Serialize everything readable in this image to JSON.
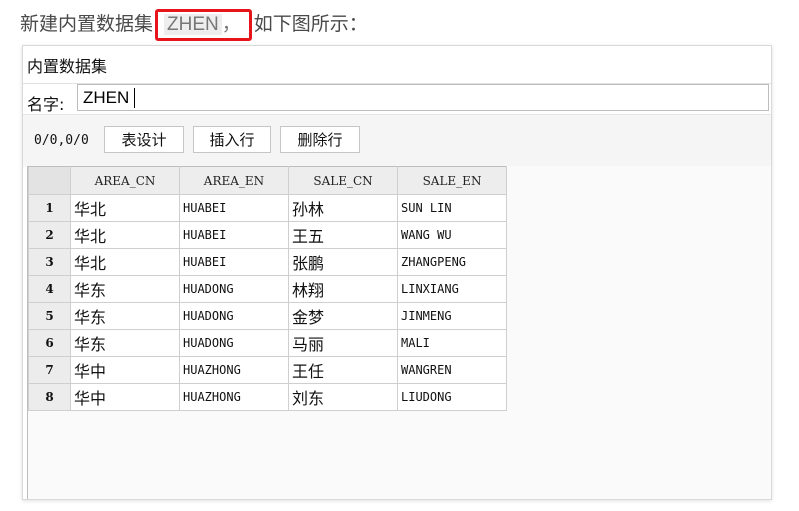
{
  "caption": {
    "before": "新建内置数据集",
    "highlight": "ZHEN",
    "highlight_suffix": "，",
    "after": "如下图所示：",
    "highlight_color": "#e8141c"
  },
  "dialog": {
    "title": "内置数据集",
    "name_label": "名字:",
    "name_value": "ZHEN"
  },
  "toolbar": {
    "count": "0/0,0/0",
    "table_design": "表设计",
    "insert_row": "插入行",
    "delete_row": "删除行"
  },
  "grid": {
    "columns": [
      "AREA_CN",
      "AREA_EN",
      "SALE_CN",
      "SALE_EN"
    ],
    "rows": [
      {
        "num": "1",
        "area_cn": "华北",
        "area_en": "HUABEI",
        "sale_cn": "孙林",
        "sale_en": "SUN LIN"
      },
      {
        "num": "2",
        "area_cn": "华北",
        "area_en": "HUABEI",
        "sale_cn": "王五",
        "sale_en": "WANG WU"
      },
      {
        "num": "3",
        "area_cn": "华北",
        "area_en": "HUABEI",
        "sale_cn": "张鹏",
        "sale_en": "ZHANGPENG"
      },
      {
        "num": "4",
        "area_cn": "华东",
        "area_en": "HUADONG",
        "sale_cn": "林翔",
        "sale_en": "LINXIANG"
      },
      {
        "num": "5",
        "area_cn": "华东",
        "area_en": "HUADONG",
        "sale_cn": "金梦",
        "sale_en": "JINMENG"
      },
      {
        "num": "6",
        "area_cn": "华东",
        "area_en": "HUADONG",
        "sale_cn": "马丽",
        "sale_en": "MALI"
      },
      {
        "num": "7",
        "area_cn": "华中",
        "area_en": "HUAZHONG",
        "sale_cn": "王任",
        "sale_en": "WANGREN"
      },
      {
        "num": "8",
        "area_cn": "华中",
        "area_en": "HUAZHONG",
        "sale_cn": "刘东",
        "sale_en": "LIUDONG"
      }
    ]
  }
}
